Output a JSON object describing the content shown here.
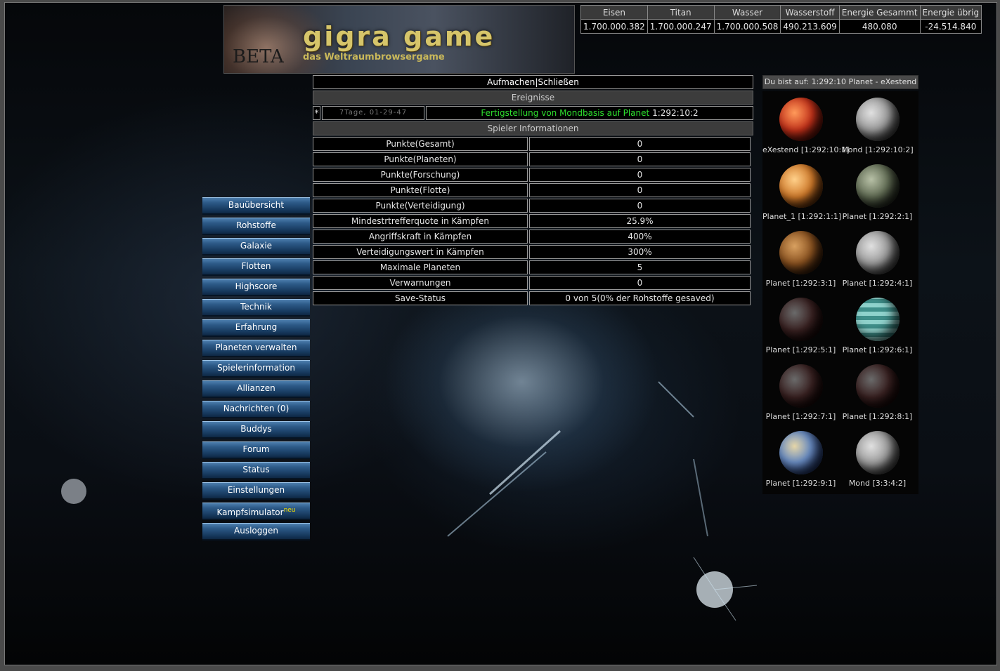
{
  "header": {
    "logo_title": "gigra game",
    "logo_subtitle": "das Weltraumbrowsergame",
    "logo_badge": "BETA"
  },
  "resources": {
    "headers": [
      "Eisen",
      "Titan",
      "Wasser",
      "Wasserstoff",
      "Energie Gesammt",
      "Energie übrig"
    ],
    "values": [
      "1.700.000.382",
      "1.700.000.247",
      "1.700.000.508",
      "490.213.609",
      "480.080",
      "-24.514.840"
    ]
  },
  "main": {
    "toggle_open": "Aufmachen",
    "toggle_sep": "|",
    "toggle_close": "Schließen",
    "events_title": "Ereignisse",
    "event": {
      "marker": "*",
      "time": "7Tage, 01-29-47",
      "text_green": "Fertigstellung von Mondbasis auf Planet",
      "coords": "1:292:10:2"
    },
    "player_info_title": "Spieler Informationen",
    "rows": [
      {
        "label": "Punkte(Gesamt)",
        "value": "0"
      },
      {
        "label": "Punkte(Planeten)",
        "value": "0"
      },
      {
        "label": "Punkte(Forschung)",
        "value": "0"
      },
      {
        "label": "Punkte(Flotte)",
        "value": "0"
      },
      {
        "label": "Punkte(Verteidigung)",
        "value": "0"
      },
      {
        "label": "Mindestrtrefferquote in Kämpfen",
        "value": "25.9%"
      },
      {
        "label": "Angriffskraft in Kämpfen",
        "value": "400%"
      },
      {
        "label": "Verteidigungswert in Kämpfen",
        "value": "300%"
      },
      {
        "label": "Maximale Planeten",
        "value": "5"
      },
      {
        "label": "Verwarnungen",
        "value": "0"
      },
      {
        "label": "Save-Status",
        "value": "0 von 5(0% der Rohstoffe gesaved)"
      }
    ]
  },
  "nav": {
    "items": [
      "Bauübersicht",
      "Rohstoffe",
      "Galaxie",
      "Flotten",
      "Highscore",
      "Technik",
      "Erfahrung",
      "Planeten verwalten",
      "Spielerinformation",
      "Allianzen",
      "Nachrichten (0)",
      "Buddys",
      "Forum",
      "Status",
      "Einstellungen",
      "Kampfsimulator",
      "Ausloggen"
    ],
    "kampfsimulator_badge": "neu"
  },
  "planets": {
    "location": "Du bist auf: 1:292:10 Planet - eXestend",
    "items": [
      {
        "label": "eXestend [1:292:10:1]",
        "type": "red"
      },
      {
        "label": "Mond [1:292:10:2]",
        "type": "moon"
      },
      {
        "label": "Planet_1 [1:292:1:1]",
        "type": "orange"
      },
      {
        "label": "Planet [1:292:2:1]",
        "type": "greygreen"
      },
      {
        "label": "Planet [1:292:3:1]",
        "type": "brown"
      },
      {
        "label": "Planet [1:292:4:1]",
        "type": "moon"
      },
      {
        "label": "Planet [1:292:5:1]",
        "type": "lava"
      },
      {
        "label": "Planet [1:292:6:1]",
        "type": "teal"
      },
      {
        "label": "Planet [1:292:7:1]",
        "type": "lava"
      },
      {
        "label": "Planet [1:292:8:1]",
        "type": "lava"
      },
      {
        "label": "Planet [1:292:9:1]",
        "type": "earth"
      },
      {
        "label": "Mond [3:3:4:2]",
        "type": "moon"
      }
    ]
  },
  "colors": {
    "event_green": "#2ee02e",
    "nav_blue": "#2d5a88",
    "badge_yellow": "#f4e000"
  }
}
